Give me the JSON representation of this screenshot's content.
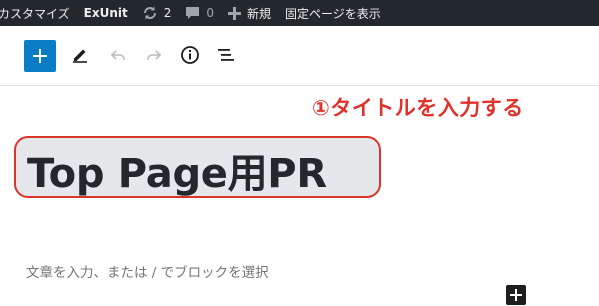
{
  "adminbar": {
    "customize_label": "カスタマイズ",
    "exunit_label": "ExUnit",
    "updates_count": "2",
    "comments_count": "0",
    "new_label": "新規",
    "view_page_label": "固定ページを表示"
  },
  "toolbar": {
    "icons": [
      "add-block-icon",
      "edit-pencil-icon",
      "undo-icon",
      "redo-icon",
      "info-icon",
      "list-view-icon"
    ]
  },
  "annotation": {
    "text": "①タイトルを入力する",
    "color": "#e0322a"
  },
  "editor": {
    "title": "Top Page用PR",
    "placeholder": "文章を入力、または / でブロックを選択"
  },
  "colors": {
    "adminbar_bg": "#23282d",
    "primary_button": "#0a7bc5",
    "highlight_border": "#d9352b"
  }
}
